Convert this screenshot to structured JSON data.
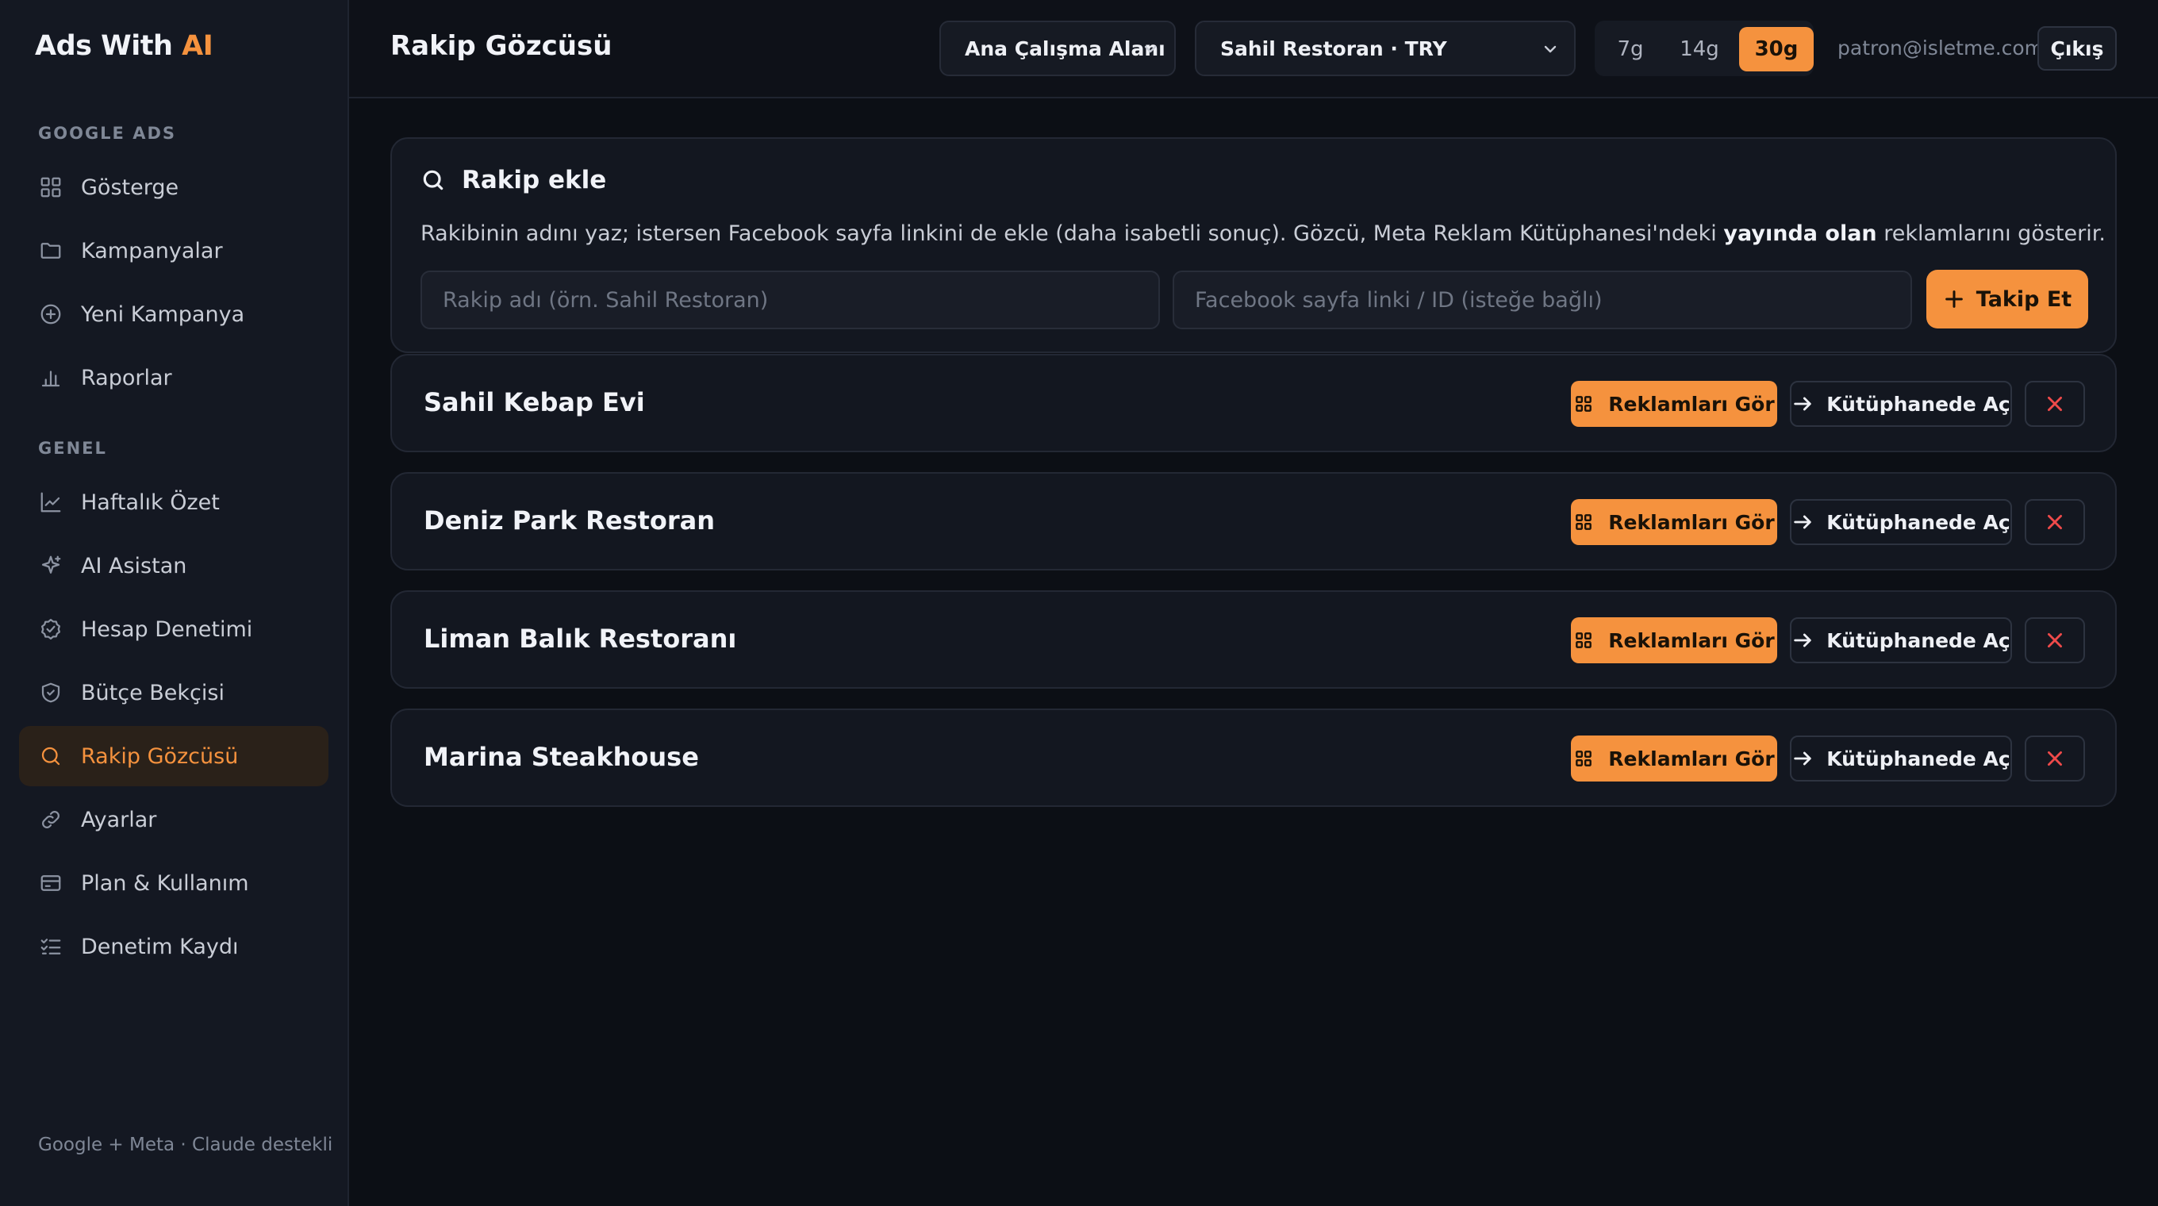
{
  "brand": {
    "name": "Ads With",
    "accent": "AI"
  },
  "sidebar": {
    "section_google": "GOOGLE ADS",
    "section_general": "GENEL",
    "google_items": [
      {
        "label": "Gösterge",
        "icon": "grid-icon"
      },
      {
        "label": "Kampanyalar",
        "icon": "folder-icon"
      },
      {
        "label": "Yeni Kampanya",
        "icon": "plus-circle-icon"
      },
      {
        "label": "Raporlar",
        "icon": "bar-chart-icon"
      }
    ],
    "general_items": [
      {
        "label": "Haftalık Özet",
        "icon": "line-chart-icon"
      },
      {
        "label": "AI Asistan",
        "icon": "sparkle-icon"
      },
      {
        "label": "Hesap Denetimi",
        "icon": "badge-check-icon"
      },
      {
        "label": "Bütçe Bekçisi",
        "icon": "shield-check-icon"
      },
      {
        "label": "Rakip Gözcüsü",
        "icon": "search-icon",
        "active": true
      },
      {
        "label": "Ayarlar",
        "icon": "link-icon"
      },
      {
        "label": "Plan & Kullanım",
        "icon": "credit-card-icon"
      },
      {
        "label": "Denetim Kaydı",
        "icon": "list-checks-icon"
      }
    ],
    "footer": "Google + Meta · Claude destekli"
  },
  "header": {
    "title": "Rakip Gözcüsü",
    "workspace": "Ana Çalışma Alanı",
    "account": "Sahil Restoran · TRY",
    "ranges": [
      "7g",
      "14g",
      "30g"
    ],
    "active_range": "30g",
    "email": "patron@isletme.com",
    "logout": "Çıkış"
  },
  "add_competitor": {
    "title": "Rakip ekle",
    "desc_before": "Rakibinin adını yaz; istersen Facebook sayfa linkini de ekle (daha isabetli sonuç). Gözcü, Meta Reklam Kütüphanesi'ndeki ",
    "desc_bold": "yayında olan",
    "desc_after": " reklamlarını gösterir.",
    "name_placeholder": "Rakip adı (örn. Sahil Restoran)",
    "fb_placeholder": "Facebook sayfa linki / ID (isteğe bağlı)",
    "follow_label": "Takip Et"
  },
  "competitors": [
    {
      "name": "Sahil Kebap Evi"
    },
    {
      "name": "Deniz Park Restoran"
    },
    {
      "name": "Liman Balık Restoranı"
    },
    {
      "name": "Marina Steakhouse"
    }
  ],
  "actions": {
    "view_ads": "Reklamları Gör",
    "open_library": "Kütüphanede Aç"
  },
  "colors": {
    "accent": "#f5923e",
    "danger": "#ef4a4a",
    "background": "#0c0f15",
    "sidebar": "#141822"
  }
}
